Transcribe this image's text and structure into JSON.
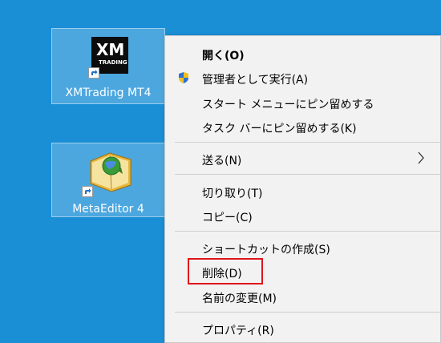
{
  "desktop": {
    "icons": [
      {
        "label": "XMTrading MT4",
        "logo_text": "XM",
        "logo_sub": "TRADING",
        "icon": "xm-logo-icon"
      },
      {
        "label": "MetaEditor 4",
        "icon": "metaeditor-book-icon"
      }
    ],
    "background_color": "#1a8fd6"
  },
  "context_menu": {
    "items": [
      {
        "label": "開く(O)",
        "bold": true
      },
      {
        "label": "管理者として実行(A)",
        "icon": "uac-shield-icon"
      },
      {
        "label": "スタート メニューにピン留めする"
      },
      {
        "label": "タスク バーにピン留めする(K)"
      },
      {
        "label": "送る(N)",
        "submenu": true
      },
      {
        "label": "切り取り(T)"
      },
      {
        "label": "コピー(C)"
      },
      {
        "label": "ショートカットの作成(S)"
      },
      {
        "label": "削除(D)",
        "highlighted": true
      },
      {
        "label": "名前の変更(M)"
      },
      {
        "label": "プロパティ(R)"
      }
    ],
    "highlight_color": "#e0141b"
  }
}
